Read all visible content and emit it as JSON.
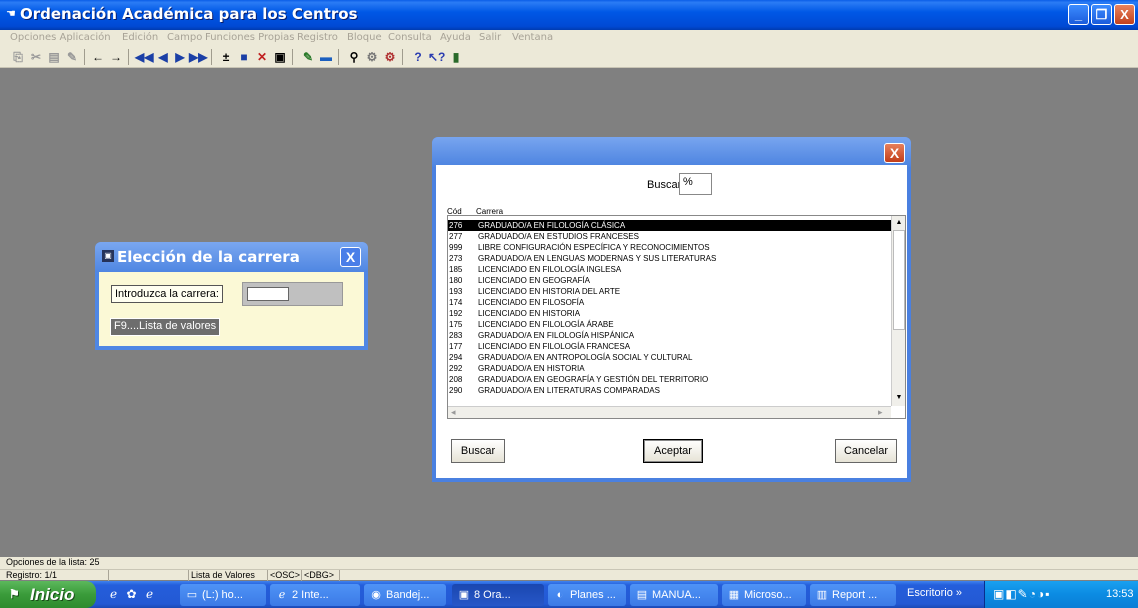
{
  "window": {
    "title": "Ordenación Académica para los Centros",
    "controls": {
      "minimize": "_",
      "maximize": "❐",
      "close": "X"
    }
  },
  "menu": [
    "Opciones Aplicación",
    "Edición",
    "Campo",
    "Funciones Propias",
    "Registro",
    "Bloque",
    "Consulta",
    "Ayuda",
    "Salir",
    "Ventana"
  ],
  "eleccion_dialog": {
    "title": "Elección de la carrera",
    "close": "X",
    "prompt_label": "Introduzca la carrera:",
    "f9_label": "F9....Lista de valores"
  },
  "lov_dialog": {
    "close": "X",
    "search_label": "Buscar",
    "search_value": "%",
    "col_cod": "Cód",
    "col_carrera": "Carrera",
    "rows": [
      {
        "cod": "276",
        "name": "GRADUADO/A EN FILOLOGÍA CLÁSICA",
        "selected": true
      },
      {
        "cod": "277",
        "name": "GRADUADO/A EN ESTUDIOS FRANCESES"
      },
      {
        "cod": "999",
        "name": "LIBRE CONFIGURACIÓN ESPECÍFICA Y RECONOCIMIENTOS"
      },
      {
        "cod": "273",
        "name": "GRADUADO/A EN LENGUAS MODERNAS Y SUS LITERATURAS"
      },
      {
        "cod": "185",
        "name": "LICENCIADO EN FILOLOGÍA INGLESA"
      },
      {
        "cod": "180",
        "name": "LICENCIADO EN GEOGRAFÍA"
      },
      {
        "cod": "193",
        "name": "LICENCIADO EN HISTORIA DEL ARTE"
      },
      {
        "cod": "174",
        "name": "LICENCIADO EN FILOSOFÍA"
      },
      {
        "cod": "192",
        "name": "LICENCIADO EN HISTORIA"
      },
      {
        "cod": "175",
        "name": "LICENCIADO EN FILOLOGÍA ÁRABE"
      },
      {
        "cod": "283",
        "name": "GRADUADO/A EN FILOLOGÍA HISPÁNICA"
      },
      {
        "cod": "177",
        "name": "LICENCIADO EN FILOLOGÍA FRANCESA"
      },
      {
        "cod": "294",
        "name": "GRADUADO/A EN ANTROPOLOGÍA SOCIAL Y CULTURAL"
      },
      {
        "cod": "292",
        "name": "GRADUADO/A EN HISTORIA"
      },
      {
        "cod": "208",
        "name": "GRADUADO/A EN GEOGRAFÍA Y GESTIÓN DEL TERRITORIO"
      },
      {
        "cod": "290",
        "name": "GRADUADO/A EN LITERATURAS COMPARADAS"
      }
    ],
    "btn_buscar": "Buscar",
    "btn_aceptar": "Aceptar",
    "btn_cancelar": "Cancelar"
  },
  "status": {
    "line1": "Opciones de la lista: 25",
    "registro": "Registro: 1/1",
    "lista": "Lista de Valores",
    "osc": "<OSC>",
    "dbg": "<DBG>"
  },
  "taskbar": {
    "start": "Inicio",
    "tasks": [
      "(L:) ho...",
      "2 Inte...",
      "Bandej...",
      "8 Ora...",
      "Planes ...",
      "MANUA...",
      "Microso...",
      "Report ..."
    ],
    "escritorio": "Escritorio",
    "clock": "13:53"
  },
  "icons": [
    "app-icon",
    "windows-flag-icon",
    "toolbar-icons"
  ]
}
